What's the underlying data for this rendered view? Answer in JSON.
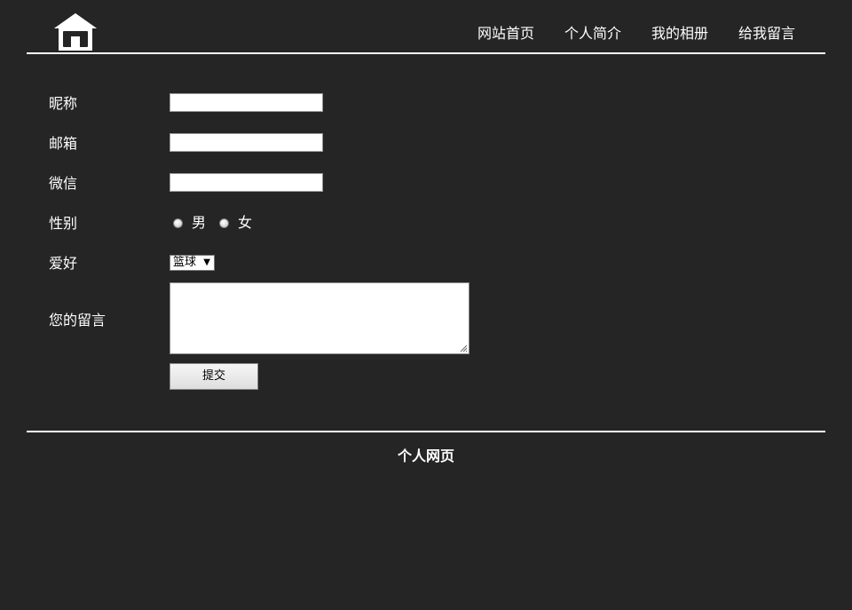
{
  "header": {
    "logo_icon": "home-icon",
    "nav": [
      {
        "label": "网站首页"
      },
      {
        "label": "个人简介"
      },
      {
        "label": "我的相册"
      },
      {
        "label": "给我留言"
      }
    ]
  },
  "form": {
    "nickname": {
      "label": "昵称",
      "value": ""
    },
    "email": {
      "label": "邮箱",
      "value": ""
    },
    "wechat": {
      "label": "微信",
      "value": ""
    },
    "gender": {
      "label": "性别",
      "options": [
        "男",
        "女"
      ]
    },
    "hobby": {
      "label": "爱好",
      "selected": "篮球"
    },
    "message": {
      "label": "您的留言",
      "value": ""
    },
    "submit_label": "提交"
  },
  "footer": {
    "title": "个人网页"
  },
  "colors": {
    "background": "#252525",
    "text": "#ffffff",
    "rule": "#ffffff"
  }
}
